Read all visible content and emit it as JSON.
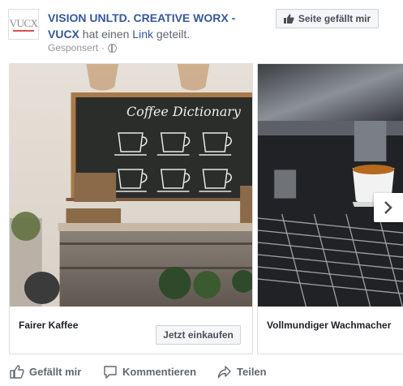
{
  "post": {
    "page_name": "VISION UNLTD. CREATIVE WORX - VUCX",
    "shared_prefix": "hat einen",
    "shared_link": "Link",
    "shared_suffix": "geteilt.",
    "sponsored": "Gesponsert",
    "separator": "·",
    "logo_text": "VUCX"
  },
  "like_page_button": {
    "label": "Seite gefällt mir",
    "icon": "thumbs-up-icon"
  },
  "carousel": {
    "cards": [
      {
        "title": "Fairer Kaffee",
        "button": "Jetzt einkaufen",
        "image": "coffee-shop-chalkboard-photo"
      },
      {
        "title": "Vollmundiger Wachmacher",
        "image": "espresso-machine-photo"
      }
    ],
    "next_icon": "chevron-right-icon"
  },
  "actions": {
    "like": "Gefällt mir",
    "comment": "Kommentieren",
    "share": "Teilen"
  },
  "chalkboard": {
    "title": "Coffee Dictionary"
  },
  "colors": {
    "link": "#365899",
    "muted": "#90949c",
    "border": "#dddfe2"
  }
}
